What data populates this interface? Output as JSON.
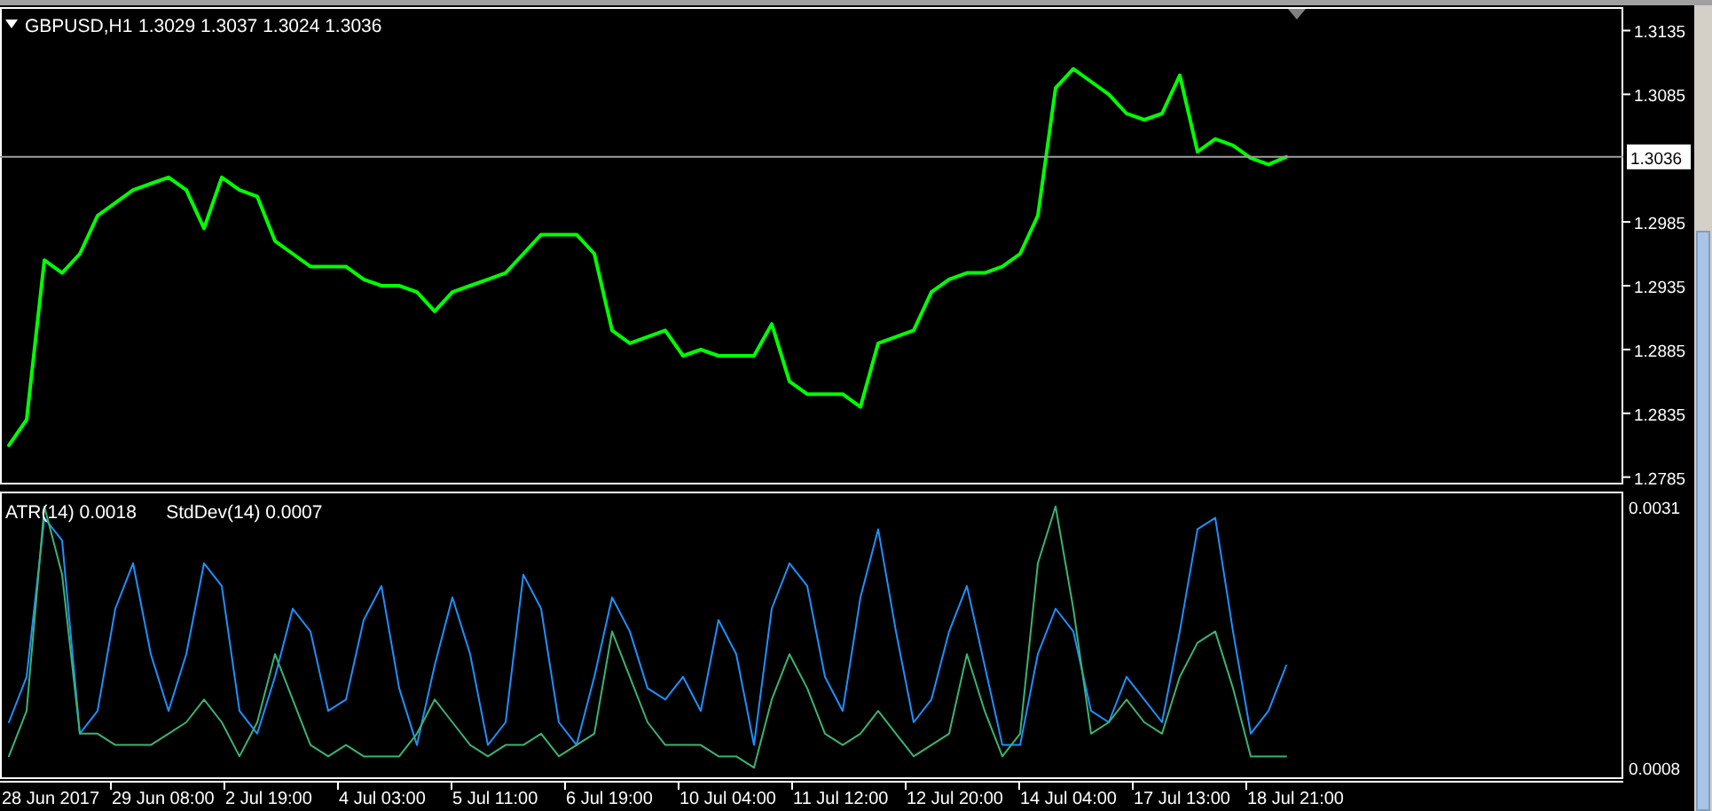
{
  "price_panel": {
    "symbol": "GBPUSD,H1",
    "quote": [
      "1.3029",
      "1.3037",
      "1.3024",
      "1.3036"
    ],
    "chart_data": {
      "type": "line",
      "ylim": [
        1.2782,
        1.3152
      ],
      "yticks": [
        {
          "value": 1.3135,
          "label": "1.3135"
        },
        {
          "value": 1.3085,
          "label": "1.3085"
        },
        {
          "value": 1.2985,
          "label": "1.2985"
        },
        {
          "value": 1.2935,
          "label": "1.2935"
        },
        {
          "value": 1.2885,
          "label": "1.2885"
        },
        {
          "value": 1.2835,
          "label": "1.2835"
        },
        {
          "value": 1.2785,
          "label": "1.2785"
        }
      ],
      "ref_lines": [
        {
          "axis": "y",
          "value": 1.3036,
          "label": "1.3036"
        }
      ],
      "series": [
        {
          "color": "#00ff00",
          "values": [
            1.281,
            1.283,
            1.2955,
            1.2945,
            1.296,
            1.299,
            1.3,
            1.301,
            1.3015,
            1.302,
            1.301,
            1.298,
            1.302,
            1.301,
            1.3005,
            1.297,
            1.296,
            1.295,
            1.295,
            1.295,
            1.294,
            1.2935,
            1.2935,
            1.293,
            1.2915,
            1.293,
            1.2935,
            1.294,
            1.2945,
            1.296,
            1.2975,
            1.2975,
            1.2975,
            1.296,
            1.29,
            1.289,
            1.2895,
            1.29,
            1.288,
            1.2885,
            1.288,
            1.288,
            1.288,
            1.2905,
            1.286,
            1.285,
            1.285,
            1.285,
            1.284,
            1.289,
            1.2895,
            1.29,
            1.293,
            1.294,
            1.2945,
            1.2945,
            1.295,
            1.296,
            1.299,
            1.309,
            1.3105,
            1.3095,
            1.3085,
            1.307,
            1.3065,
            1.307,
            1.31,
            1.304,
            1.305,
            1.3045,
            1.3035,
            1.303,
            1.3036
          ]
        }
      ]
    }
  },
  "indicator_panel": {
    "legend_values": [
      "0.0018",
      "0.0007"
    ],
    "chart_data": {
      "type": "line",
      "ylim": [
        0.0007,
        0.0032
      ],
      "yticks": [
        {
          "value": 0.0031,
          "label": "0.0031"
        },
        {
          "value": 0.0008,
          "label": "0.0008"
        }
      ],
      "series": [
        {
          "name": "ATR(14)",
          "color": "#1e90ff",
          "values": [
            0.0012,
            0.0016,
            0.003,
            0.0028,
            0.0011,
            0.0013,
            0.0022,
            0.0026,
            0.0018,
            0.0013,
            0.0018,
            0.0026,
            0.0024,
            0.0013,
            0.0011,
            0.0016,
            0.0022,
            0.002,
            0.0013,
            0.0014,
            0.0021,
            0.0024,
            0.0015,
            0.001,
            0.0017,
            0.0023,
            0.0018,
            0.001,
            0.0012,
            0.0025,
            0.0022,
            0.0012,
            0.001,
            0.0016,
            0.0023,
            0.002,
            0.0015,
            0.0014,
            0.0016,
            0.0013,
            0.0021,
            0.0018,
            0.001,
            0.0022,
            0.0026,
            0.0024,
            0.0016,
            0.0013,
            0.0023,
            0.0029,
            0.002,
            0.0012,
            0.0014,
            0.002,
            0.0024,
            0.0017,
            0.001,
            0.001,
            0.0018,
            0.0022,
            0.002,
            0.0013,
            0.0012,
            0.0016,
            0.0014,
            0.0012,
            0.002,
            0.0029,
            0.003,
            0.002,
            0.0011,
            0.0013,
            0.0017
          ]
        },
        {
          "name": "StdDev(14)",
          "color": "#3cb371",
          "values": [
            0.0009,
            0.0013,
            0.0031,
            0.0025,
            0.0011,
            0.0011,
            0.001,
            0.001,
            0.001,
            0.0011,
            0.0012,
            0.0014,
            0.0012,
            0.0009,
            0.0012,
            0.0018,
            0.0014,
            0.001,
            0.0009,
            0.001,
            0.0009,
            0.0009,
            0.0009,
            0.0011,
            0.0014,
            0.0012,
            0.001,
            0.0009,
            0.001,
            0.001,
            0.0011,
            0.0009,
            0.001,
            0.0011,
            0.002,
            0.0016,
            0.0012,
            0.001,
            0.001,
            0.001,
            0.0009,
            0.0009,
            0.0008,
            0.0014,
            0.0018,
            0.0015,
            0.0011,
            0.001,
            0.0011,
            0.0013,
            0.0011,
            0.0009,
            0.001,
            0.0011,
            0.0018,
            0.0013,
            0.0009,
            0.0011,
            0.0026,
            0.0031,
            0.0022,
            0.0011,
            0.0012,
            0.0014,
            0.0012,
            0.0011,
            0.0016,
            0.0019,
            0.002,
            0.0015,
            0.0009,
            0.0009,
            0.0009
          ]
        }
      ]
    }
  },
  "time_axis": [
    "28 Jun 2017",
    "29 Jun 08:00",
    "2 Jul 19:00",
    "4 Jul 03:00",
    "5 Jul 11:00",
    "6 Jul 19:00",
    "10 Jul 04:00",
    "11 Jul 12:00",
    "12 Jul 20:00",
    "14 Jul 04:00",
    "17 Jul 13:00",
    "18 Jul 21:00"
  ]
}
